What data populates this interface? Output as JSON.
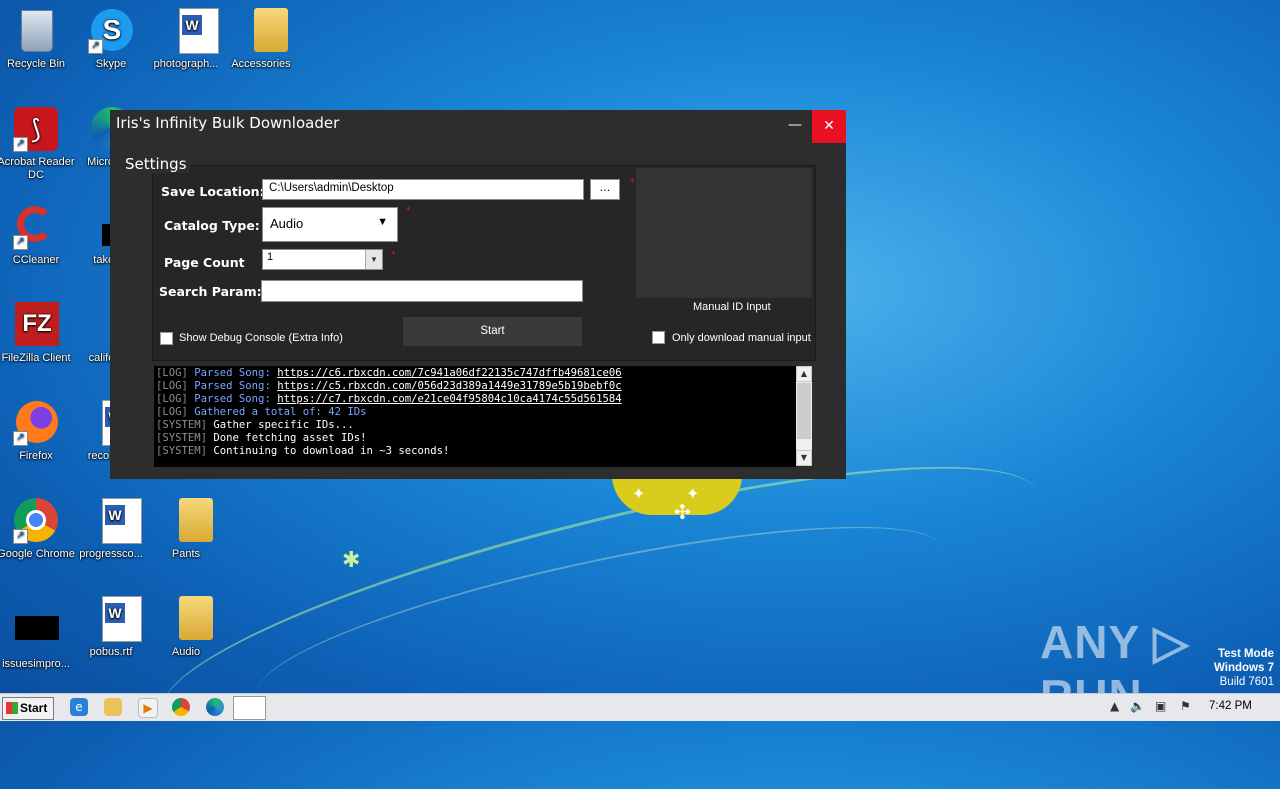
{
  "desktop": {
    "icons": [
      {
        "label": "Recycle Bin"
      },
      {
        "label": "Skype"
      },
      {
        "label": "photograph..."
      },
      {
        "label": "Accessories"
      },
      {
        "label": "Acrobat Reader DC"
      },
      {
        "label": "Microso..."
      },
      {
        "label": "CCleaner"
      },
      {
        "label": "taketi..."
      },
      {
        "label": "FileZilla Client"
      },
      {
        "label": "californ..."
      },
      {
        "label": "Firefox"
      },
      {
        "label": "recordo..."
      },
      {
        "label": "Google Chrome"
      },
      {
        "label": "progressco..."
      },
      {
        "label": "Pants"
      },
      {
        "label": "issuesimpro..."
      },
      {
        "label": "pobus.rtf"
      },
      {
        "label": "Audio"
      }
    ],
    "watermark": "ANY ▷ RUN",
    "test_mode": {
      "line1": "Test Mode",
      "line2": "Windows 7",
      "line3": "Build 7601"
    }
  },
  "window": {
    "title": "Iris's Infinity Bulk Downloader",
    "minimize": "—",
    "close": "✕",
    "settings": {
      "group_label": "Settings",
      "save_location_label": "Save Location:",
      "save_location_value": "C:\\Users\\admin\\Desktop",
      "browse_label": "...",
      "catalog_type_label": "Catalog Type:",
      "catalog_type_value": "Audio",
      "page_count_label": "Page Count",
      "page_count_value": "1",
      "search_param_label": "Search Param:",
      "search_param_value": "",
      "manual_id_label": "Manual ID Input",
      "debug_label": "Show Debug Console (Extra Info)",
      "start_label": "Start",
      "only_manual_label": "Only download manual input",
      "required_mark": "*"
    },
    "log": [
      {
        "tag": "[LOG]",
        "prefix": "Parsed Song:",
        "text": "https://c6.rbxcdn.com/7c941a06df22135c747dffb49681ce06",
        "style": "link"
      },
      {
        "tag": "[LOG]",
        "prefix": "Parsed Song:",
        "text": "https://c5.rbxcdn.com/056d23d389a1449e31789e5b19bebf0c",
        "style": "link"
      },
      {
        "tag": "[LOG]",
        "prefix": "Parsed Song:",
        "text": "https://c7.rbxcdn.com/e21ce04f95804c10ca4174c55d561584",
        "style": "link"
      },
      {
        "tag": "[LOG]",
        "prefix": "Gathered a total of: 42 IDs",
        "text": "",
        "style": "blue"
      },
      {
        "tag": "[SYSTEM]",
        "prefix": "",
        "text": "Gather specific IDs...",
        "style": "white"
      },
      {
        "tag": "[SYSTEM]",
        "prefix": "",
        "text": "Done fetching asset IDs!",
        "style": "white"
      },
      {
        "tag": "[SYSTEM]",
        "prefix": "",
        "text": "Continuing to download in ~3 seconds!",
        "style": "white"
      }
    ]
  },
  "taskbar": {
    "start_label": "Start",
    "clock": "7:42 PM"
  }
}
